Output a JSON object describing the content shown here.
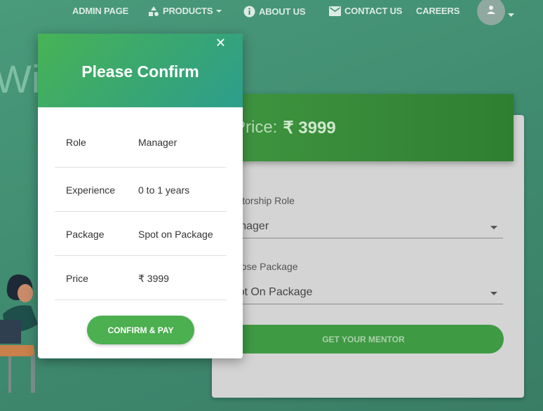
{
  "navbar": {
    "items": [
      {
        "label": "ADMIN PAGE"
      },
      {
        "label": "PRODUCTS"
      },
      {
        "label": "ABOUT US"
      },
      {
        "label": "CONTACT US"
      },
      {
        "label": "CAREERS"
      }
    ],
    "avatar_icon": "person-icon"
  },
  "hero": {
    "text": "With"
  },
  "form": {
    "price_label": "Price:",
    "price_value": "₹ 3999",
    "role_label": "Mentorship Role",
    "role_value": "Manager",
    "package_label": "Choose Package",
    "package_value": "Spot On Package",
    "submit_label": "GET YOUR MENTOR"
  },
  "modal": {
    "title": "Please Confirm",
    "close_label": "✕",
    "rows": [
      {
        "key": "Role",
        "value": "Manager"
      },
      {
        "key": "Experience",
        "value": "0 to 1 years"
      },
      {
        "key": "Package",
        "value": "Spot on Package"
      },
      {
        "key": "Price",
        "value": "₹ 3999"
      }
    ],
    "confirm_label": "CONFIRM & PAY"
  },
  "colors": {
    "background": "#3f8a6f",
    "modal_header_start": "#47b356",
    "modal_header_end": "#2c9e8c",
    "confirm_button": "#4caf50",
    "price_banner": "#3f9540"
  }
}
